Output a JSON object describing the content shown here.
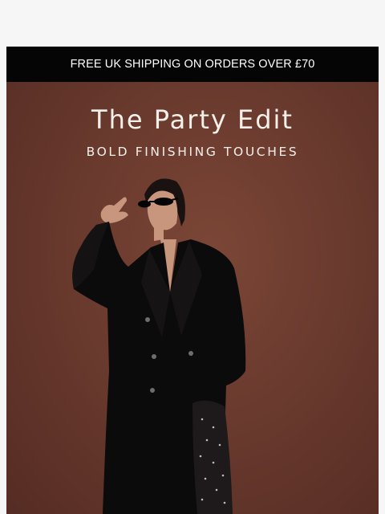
{
  "promo": {
    "text": "FREE UK SHIPPING ON ORDERS OVER £70"
  },
  "hero": {
    "title": "The Party Edit",
    "subtitle": "BOLD FINISHING TOUCHES",
    "image_icon": "model-in-black-coat-photo",
    "colors": {
      "background": "#6a3a2e",
      "coat": "#0c0b0c",
      "text": "#f4efe9"
    }
  }
}
